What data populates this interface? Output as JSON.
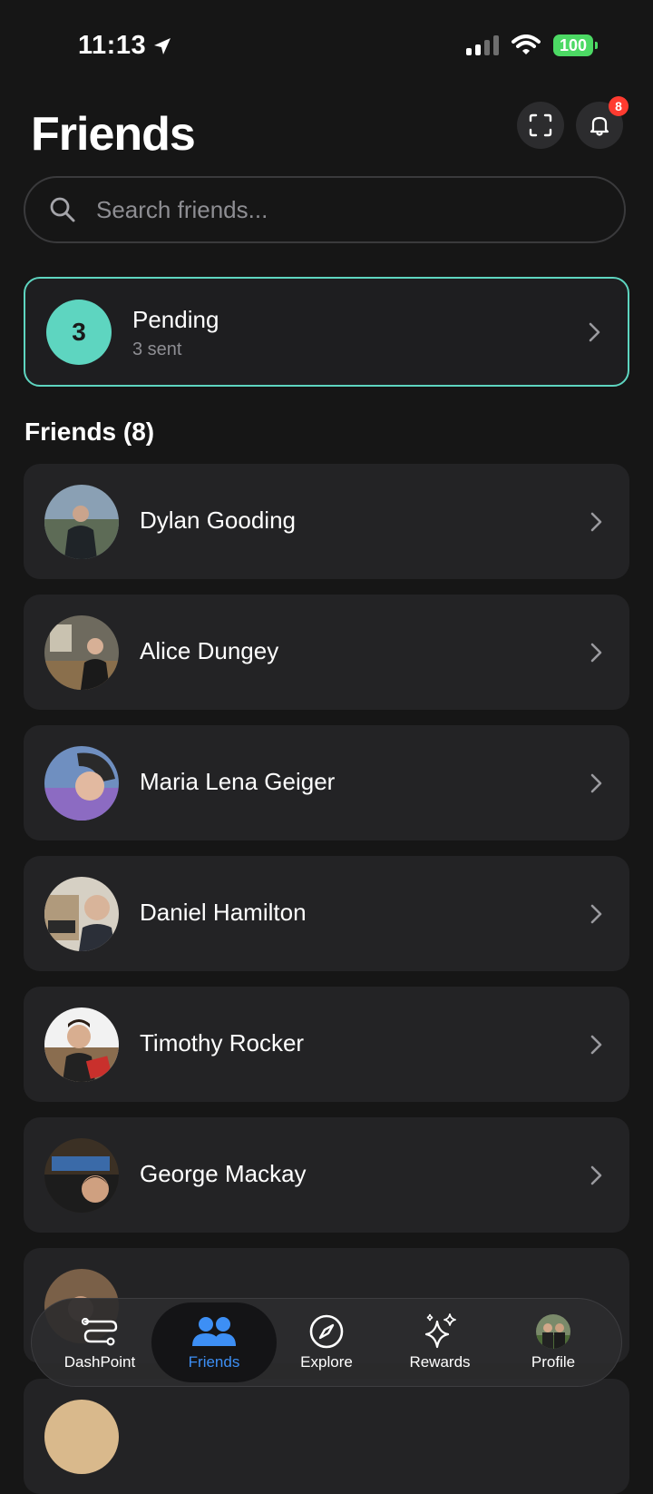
{
  "status_bar": {
    "time": "11:13",
    "battery": "100"
  },
  "header": {
    "title": "Friends",
    "notification_count": "8"
  },
  "search": {
    "placeholder": "Search friends..."
  },
  "pending": {
    "count": "3",
    "title": "Pending",
    "subtitle": "3 sent"
  },
  "friends_section": {
    "title": "Friends (8)",
    "items": [
      {
        "name": "Dylan Gooding"
      },
      {
        "name": "Alice Dungey"
      },
      {
        "name": "Maria Lena Geiger"
      },
      {
        "name": "Daniel Hamilton"
      },
      {
        "name": "Timothy Rocker"
      },
      {
        "name": "George Mackay"
      }
    ]
  },
  "tabbar": {
    "tabs": [
      {
        "label": "DashPoint",
        "icon": "dashpoint-icon"
      },
      {
        "label": "Friends",
        "icon": "friends-icon",
        "active": true
      },
      {
        "label": "Explore",
        "icon": "compass-icon"
      },
      {
        "label": "Rewards",
        "icon": "sparkles-icon"
      },
      {
        "label": "Profile",
        "icon": "profile-avatar"
      }
    ]
  },
  "colors": {
    "background": "#161616",
    "accent_teal": "#5ed5c0",
    "active_tab_blue": "#3d8ff5",
    "badge_red": "#ff3b30",
    "battery_green": "#4cd964"
  }
}
